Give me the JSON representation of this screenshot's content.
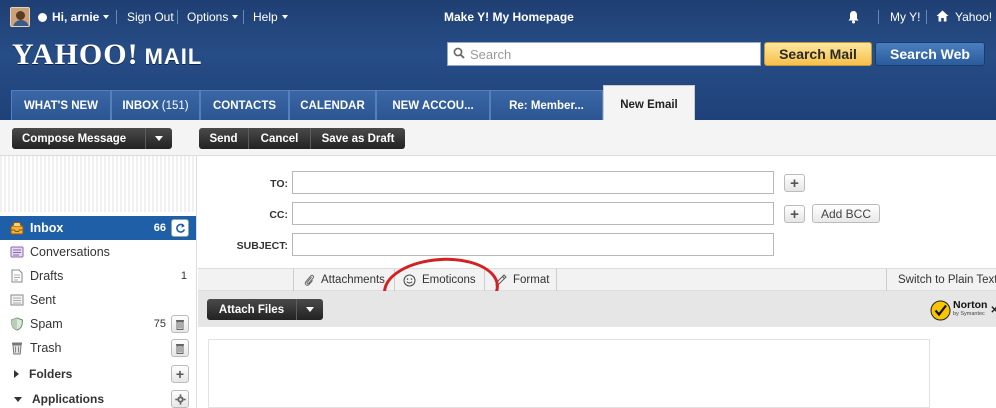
{
  "header": {
    "user_greeting": "Hi, arnie",
    "sign_out": "Sign Out",
    "options": "Options",
    "help": "Help",
    "make_homepage": "Make Y! My Homepage",
    "my_y": "My Y!",
    "yahoo_link": "Yahoo!",
    "logo_text": "YAHOO!",
    "logo_mail": "MAIL",
    "search_placeholder": "Search",
    "search_mail_label": "Search Mail",
    "search_web_label": "Search Web"
  },
  "tabs": [
    {
      "label": "WHAT'S NEW"
    },
    {
      "label": "INBOX",
      "count": "(151)"
    },
    {
      "label": "CONTACTS"
    },
    {
      "label": "CALENDAR"
    },
    {
      "label": "NEW ACCOU..."
    },
    {
      "label": "Re: Member..."
    },
    {
      "label": "New Email"
    }
  ],
  "toolbar": {
    "compose_label": "Compose Message",
    "send_label": "Send",
    "cancel_label": "Cancel",
    "save_draft_label": "Save as Draft"
  },
  "sidebar": {
    "items": [
      {
        "label": "Inbox",
        "count": "66"
      },
      {
        "label": "Conversations",
        "count": ""
      },
      {
        "label": "Drafts",
        "count": "1"
      },
      {
        "label": "Sent",
        "count": ""
      },
      {
        "label": "Spam",
        "count": "75"
      },
      {
        "label": "Trash",
        "count": ""
      }
    ],
    "folders_label": "Folders",
    "applications_label": "Applications"
  },
  "compose": {
    "to_label": "TO:",
    "cc_label": "CC:",
    "subject_label": "SUBJECT:",
    "to_value": "",
    "cc_value": "",
    "subject_value": "",
    "add_bcc_label": "Add BCC"
  },
  "format_bar": {
    "attachments_label": "Attachments",
    "emoticons_label": "Emoticons",
    "format_label": "Format",
    "plain_text_label": "Switch to Plain Text"
  },
  "attach": {
    "attach_files_label": "Attach Files"
  },
  "norton": {
    "brand": "Norton",
    "sub": "by Symantec"
  },
  "colors": {
    "header_blue": "#274d86",
    "selected_blue": "#1f5fa8",
    "search_mail_yellow": "#f6c04a",
    "annotation_red": "#d42020"
  }
}
